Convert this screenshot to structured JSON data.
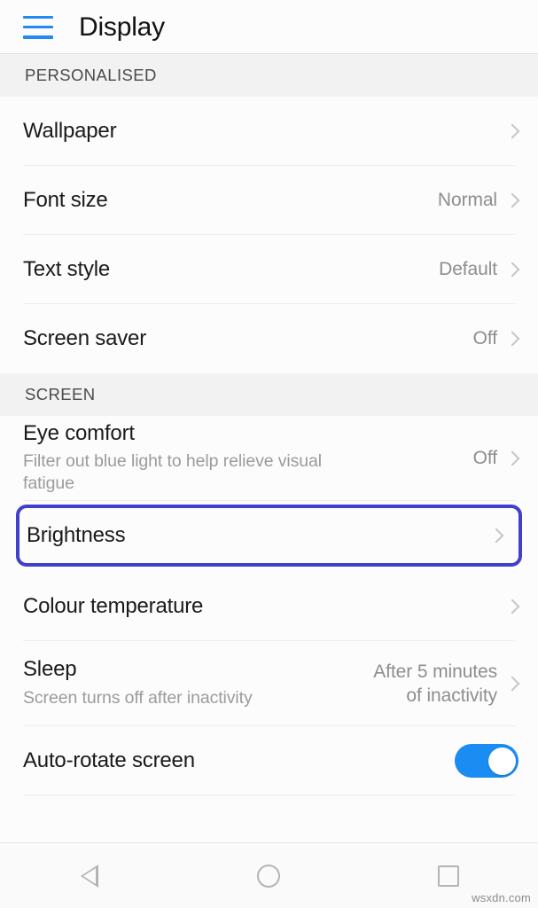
{
  "header": {
    "title": "Display",
    "menu_icon": "hamburger-menu-icon",
    "menu_color": "#2489f0"
  },
  "sections": [
    {
      "title": "PERSONALISED",
      "rows": [
        {
          "label": "Wallpaper",
          "value": "",
          "sub": "",
          "chevron": true
        },
        {
          "label": "Font size",
          "value": "Normal",
          "sub": "",
          "chevron": true
        },
        {
          "label": "Text style",
          "value": "Default",
          "sub": "",
          "chevron": true
        },
        {
          "label": "Screen saver",
          "value": "Off",
          "sub": "",
          "chevron": true
        }
      ]
    },
    {
      "title": "SCREEN",
      "rows": [
        {
          "label": "Eye comfort",
          "value": "Off",
          "sub": "Filter out blue light to help relieve visual fatigue",
          "chevron": true
        },
        {
          "label": "Brightness",
          "value": "",
          "sub": "",
          "chevron": true,
          "highlighted": true
        },
        {
          "label": "Colour temperature",
          "value": "",
          "sub": "",
          "chevron": true
        },
        {
          "label": "Sleep",
          "value": "After 5 minutes\nof inactivity",
          "sub": "Screen turns off after inactivity",
          "chevron": true
        },
        {
          "label": "Auto-rotate screen",
          "value": "",
          "sub": "",
          "chevron": false,
          "toggle": true,
          "toggle_on": true
        }
      ]
    }
  ],
  "highlight": {
    "target": "Brightness",
    "border_color": "#4040cc"
  },
  "toggle": {
    "on_color": "#1a8cf2",
    "knob_color": "#ffffff"
  },
  "navbar": {
    "back": "back-triangle-icon",
    "home": "home-circle-icon",
    "recents": "recents-square-icon"
  },
  "watermark": "wsxdn.com"
}
